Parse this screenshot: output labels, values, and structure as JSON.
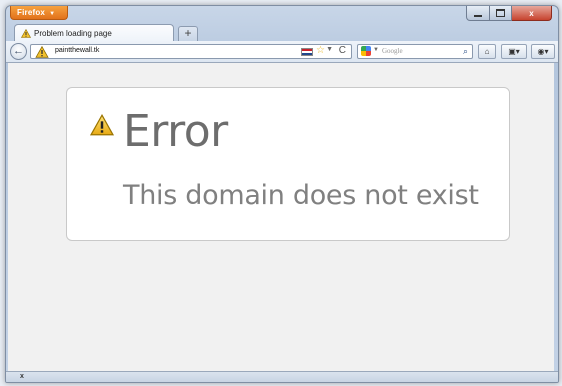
{
  "app": {
    "menu_label": "Firefox",
    "menu_caret": "▼"
  },
  "window_controls": {
    "close_label": "x"
  },
  "tabs": [
    {
      "label": "Problem loading page"
    }
  ],
  "new_tab_label": "+",
  "nav": {
    "back_label": "←",
    "url": "paintthewall.tk",
    "star": "☆",
    "dropdown": "▼",
    "reload": "C"
  },
  "search": {
    "placeholder": "Google",
    "engine_dropdown": "▼",
    "button": "⌕"
  },
  "toolbar": {
    "home": "⌂",
    "bookmarks": "▣▾",
    "addon": "◉▾"
  },
  "page": {
    "title": "Error",
    "message": "This domain does not exist"
  },
  "statusbar": {
    "close_label": "x"
  },
  "colors": {
    "firefox_orange": "#e2721b",
    "warning_yellow": "#f2c12e",
    "error_text": "#6d6d6d"
  }
}
